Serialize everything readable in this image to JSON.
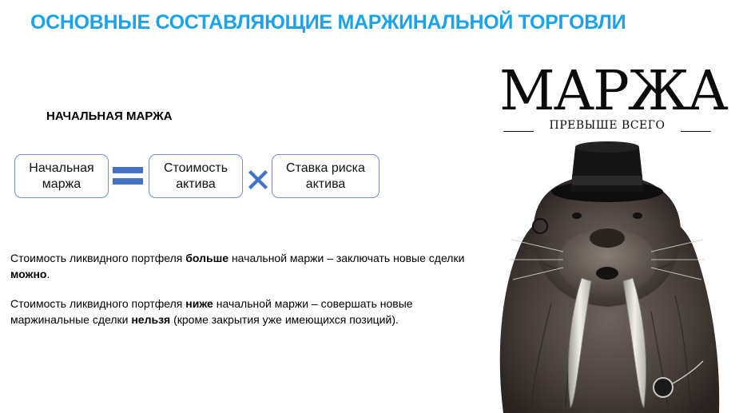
{
  "slide": {
    "title": "ОСНОВНЫЕ СОСТАВЛЯЮЩИЕ МАРЖИНАЛЬНОЙ ТОРГОВЛИ",
    "title_color": "#1aa3ea",
    "accent_color": "#4472c4"
  },
  "section": {
    "heading": "НАЧАЛЬНАЯ МАРЖА"
  },
  "formula": {
    "term_1": "Начальная маржа",
    "operator_1_icon": "equals-icon",
    "term_2": "Стоимость актива",
    "operator_2_icon": "multiply-icon",
    "term_3": "Ставка риска актива"
  },
  "paragraphs": {
    "p1": {
      "part_1": "Стоимость ликвидного портфеля ",
      "bold_1": "больше",
      "part_2": " начальной маржи – заключать новые сделки ",
      "bold_2": "можно",
      "part_3": "."
    },
    "p2": {
      "part_1": "Стоимость ликвидного портфеля ",
      "bold_1": "ниже",
      "part_2": " начальной маржи – совершать новые маржинальные сделки ",
      "bold_2": "нельзя",
      "part_3": " (кроме закрытия уже имеющихся позиций)."
    }
  },
  "poster": {
    "title": "МАРЖА",
    "subtitle": "ПРЕВЫШЕ ВСЕГО",
    "image_icon": "walrus-in-top-hat-illustration"
  }
}
